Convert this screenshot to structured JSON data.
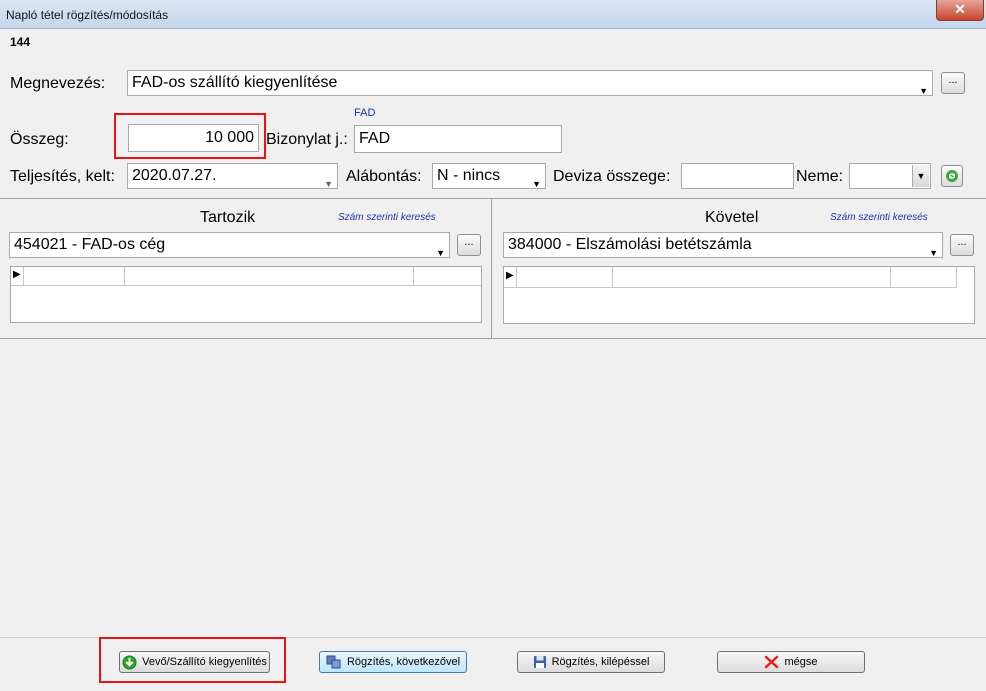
{
  "window": {
    "title": "Napló tétel rögzítés/módosítás",
    "close": "✕"
  },
  "record_id": "144",
  "labels": {
    "megnevezes": "Megnevezés:",
    "osszeg": "Összeg:",
    "bizonylat": "Bizonylat j.:",
    "teljesites": "Teljesítés, kelt:",
    "alabontas": "Alábontás:",
    "deviza": "Deviza összege:",
    "neme": "Neme:"
  },
  "fields": {
    "megnevezes": "FAD-os szállító kiegyenlítése",
    "osszeg": "10 000",
    "bizonylat_hint": "FAD",
    "bizonylat": "FAD",
    "teljesites": "2020.07.27.",
    "alabontas": "N - nincs",
    "deviza": "",
    "neme": ""
  },
  "tartozik": {
    "title": "Tartozik",
    "search_link": "Szám szerinti keresés",
    "account": "454021 - FAD-os cég"
  },
  "kovetel": {
    "title": "Követel",
    "search_link": "Szám szerinti keresés",
    "account": "384000 - Elszámolási betétszámla"
  },
  "dots_label": "...",
  "row_indicator": "▶",
  "buttons": {
    "vevo": "Vevő/Szállító kiegyenlítés",
    "rogzites_kov": "Rögzítés, következővel",
    "rogzites_kil": "Rögzítés, kilépéssel",
    "megse": "mégse"
  },
  "colors": {
    "highlight": "#e11111",
    "link": "#1a33b3",
    "ok_green": "#2aa52a",
    "cancel_red": "#e02020"
  }
}
